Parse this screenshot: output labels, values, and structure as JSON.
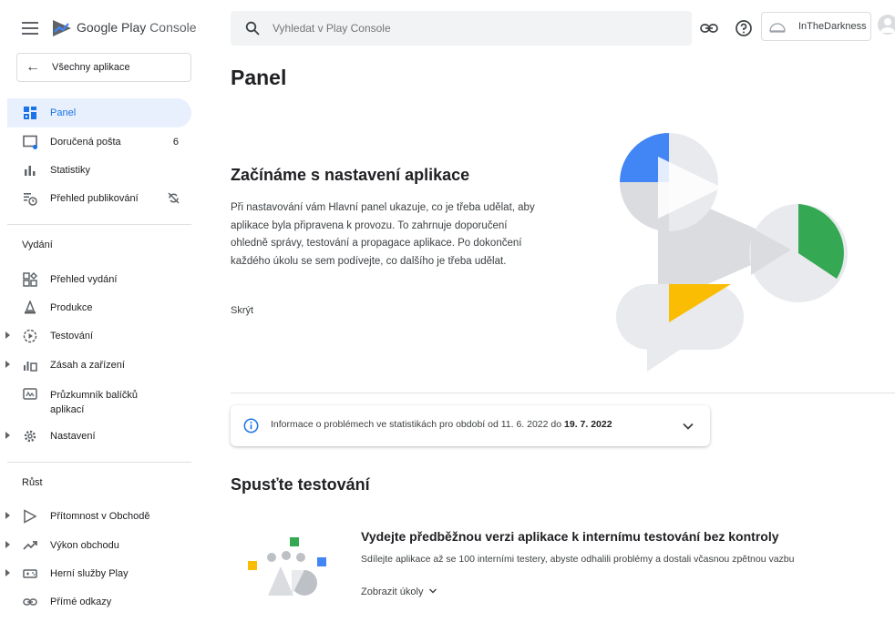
{
  "app": {
    "logo_text_prefix": "Google Play",
    "logo_text_suffix": "Console"
  },
  "sidebar": {
    "back_label": "Všechny aplikace",
    "top_items": [
      {
        "label": "Panel",
        "icon": "dashboard-icon",
        "active": true
      },
      {
        "label": "Doručená pošta",
        "icon": "inbox-icon",
        "badge": "6"
      },
      {
        "label": "Statistiky",
        "icon": "bar-chart-icon"
      },
      {
        "label": "Přehled publikování",
        "icon": "publishing-overview-icon"
      }
    ],
    "release_header": "Vydání",
    "release_items": [
      {
        "label": "Přehled vydání",
        "icon": "release-overview-icon"
      },
      {
        "label": "Produkce",
        "icon": "production-icon"
      },
      {
        "label": "Testování",
        "icon": "testing-icon",
        "expandable": true
      },
      {
        "label": "Zásah a zařízení",
        "icon": "reach-devices-icon",
        "expandable": true
      },
      {
        "label": "Průzkumník balíčků aplikací",
        "icon": "bundle-explorer-icon"
      },
      {
        "label": "Nastavení",
        "icon": "settings-gear-icon",
        "expandable": true
      }
    ],
    "growth_header": "Růst",
    "growth_items": [
      {
        "label": "Přítomnost v Obchodě",
        "icon": "store-presence-icon",
        "expandable": true
      },
      {
        "label": "Výkon obchodu",
        "icon": "trend-icon",
        "expandable": true
      },
      {
        "label": "Herní služby Play",
        "icon": "gamepad-icon",
        "expandable": true
      },
      {
        "label": "Přímé odkazy",
        "icon": "link-icon"
      }
    ]
  },
  "topbar": {
    "search_placeholder": "Vyhledat v Play Console",
    "account_name": "InTheDarkness"
  },
  "main": {
    "page_title": "Panel",
    "setup": {
      "title": "Začínáme s nastavení aplikace",
      "body": "Při nastavování vám Hlavní panel ukazuje, co je třeba udělat, aby aplikace byla připravena k provozu. To zahrnuje doporučení ohledně správy, testování a propagace aplikace. Po dokončení každého úkolu se sem podívejte, co dalšího je třeba udělat.",
      "hide_label": "Skrýt"
    },
    "info": {
      "text_prefix": "Informace o problémech ve statistikách pro období od 11. 6. 2022 do ",
      "text_bold": "19. 7. 2022"
    },
    "testing": {
      "section_title": "Spusťte testování",
      "card_title": "Vydejte předběžnou verzi aplikace k internímu testování bez kontroly",
      "card_subtitle": "Sdílejte aplikace až se 100 interními testery, abyste odhalili problémy a dostali včasnou zpětnou vazbu",
      "tasks_label": "Zobrazit úkoly"
    }
  },
  "colors": {
    "accent_blue": "#1a73e8",
    "illus_blue": "#4285f4",
    "illus_green": "#34a853",
    "illus_yellow": "#fbbc04",
    "illus_grey": "#dadce0"
  }
}
